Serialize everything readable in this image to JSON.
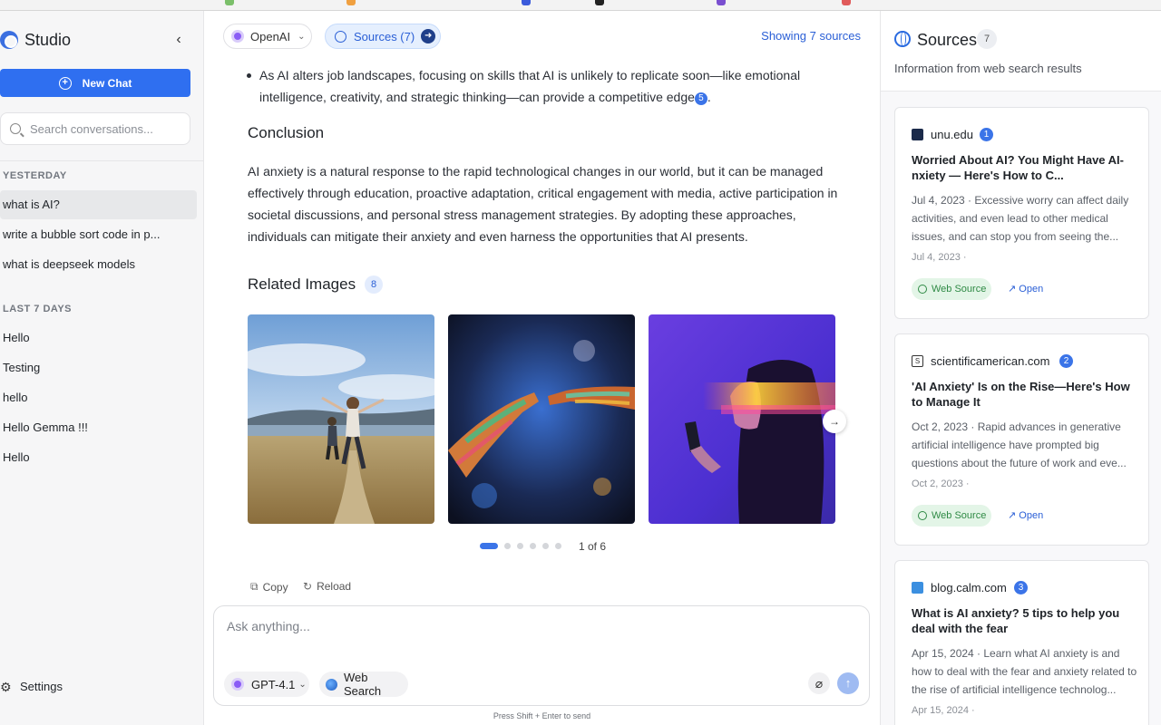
{
  "app": {
    "brand": "Studio",
    "collapse_icon": "chevron-left-icon"
  },
  "sidebar": {
    "new_chat_label": "New Chat",
    "search_placeholder": "Search conversations...",
    "groups": [
      {
        "label": "YESTERDAY",
        "items": [
          "what is AI?",
          "write a bubble sort code in p...",
          "what is deepseek models"
        ]
      },
      {
        "label": "LAST 7 DAYS",
        "items": [
          "Hello",
          "Testing",
          "hello",
          "Hello Gemma !!!",
          "Hello"
        ]
      }
    ],
    "active_item": "what is AI?",
    "settings_label": "Settings"
  },
  "toolbar": {
    "model_label": "OpenAI",
    "sources_label": "Sources (7)",
    "showing_label": "Showing 7 sources"
  },
  "message": {
    "bullet_text": "As AI alters job landscapes, focusing on skills that AI is unlikely to replicate soon—like emotional intelligence, creativity, and strategic thinking—can provide a competitive edge",
    "bullet_citation": "5",
    "bullet_end": ".",
    "conclusion_title": "Conclusion",
    "conclusion_text": "AI anxiety is a natural response to the rapid technological changes in our world, but it can be managed effectively through education, proactive adaptation, critical engagement with media, active participation in societal discussions, and personal stress management strategies. By adopting these approaches, individuals can mitigate their anxiety and even harness the opportunities that AI presents.",
    "related_images_title": "Related Images",
    "related_images_count": "8",
    "carousel_indicator": "1 of 6",
    "carousel_total_pages": 6,
    "carousel_current_page": 1,
    "copy_label": "Copy",
    "reload_label": "Reload"
  },
  "composer": {
    "placeholder": "Ask anything...",
    "model_label": "GPT-4.1",
    "web_search_label": "Web Search",
    "hint": "Press Shift + Enter to send"
  },
  "sources_panel": {
    "title": "Sources",
    "count": "7",
    "subtitle": "Information from web search results",
    "cards": [
      {
        "domain": "unu.edu",
        "number": "1",
        "title": "Worried About AI? You Might Have AI-nxiety — Here's How to C...",
        "description": "Jul 4, 2023 · Excessive worry can affect daily activities, and even lead to other medical issues, and can stop you from seeing the...",
        "date": "Jul 4, 2023 ·",
        "chip": "Web Source",
        "open": "Open",
        "favicon_color": "#1b2a4a"
      },
      {
        "domain": "scientificamerican.com",
        "number": "2",
        "title": "'AI Anxiety' Is on the Rise—Here's How to Manage It",
        "description": "Oct 2, 2023 · Rapid advances in generative artificial intelligence have prompted big questions about the future of work and eve...",
        "date": "Oct 2, 2023 ·",
        "chip": "Web Source",
        "open": "Open",
        "favicon_color": "#333333"
      },
      {
        "domain": "blog.calm.com",
        "number": "3",
        "title": "What is AI anxiety? 5 tips to help you deal with the fear",
        "description": "Apr 15, 2024 · Learn what AI anxiety is and how to deal with the fear and anxiety related to the rise of artificial intelligence technolog...",
        "date": "Apr 15, 2024 ·",
        "chip": "Web Source",
        "open": "Open",
        "favicon_color": "#3b8fe0"
      }
    ]
  },
  "colors": {
    "accent": "#2f6ff0",
    "citation": "#3b74e8",
    "chip_green": "#2f8a45"
  }
}
